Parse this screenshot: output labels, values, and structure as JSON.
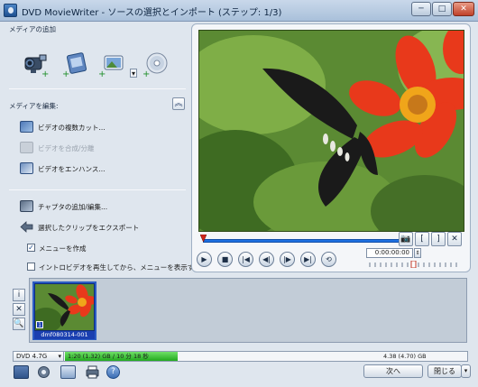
{
  "window": {
    "title": "DVD MovieWriter - ソースの選択とインポート (ステップ: 1/3)",
    "minimize": "─",
    "maximize": "□",
    "close": "✕"
  },
  "add_media": {
    "heading": "メディアの追加",
    "icons": [
      "camcorder-icon",
      "import-video-icon",
      "import-photo-icon",
      "disc-import-icon"
    ],
    "dropdown": "▾"
  },
  "edit_media": {
    "heading": "メディアを編集:",
    "collapse": "︽",
    "items": [
      {
        "label": "ビデオの複数カット...",
        "disabled": false
      },
      {
        "label": "ビデオを合成/分離",
        "disabled": true
      },
      {
        "label": "ビデオをエンハンス...",
        "disabled": false
      }
    ]
  },
  "chapter": {
    "add_chapters": "チャプタの追加/編集...",
    "export_clip": "選択したクリップをエクスポート",
    "create_menu": "メニューを作成",
    "create_menu_checked": true,
    "intro_option": "イントロビデオを再生してから、メニューを表示する",
    "intro_checked": false
  },
  "player": {
    "timecode": "0:00:00:00",
    "controls": [
      "▶",
      "■",
      "|◀",
      "◀|",
      "|▶",
      "▶|",
      "⟲"
    ],
    "camera": "📷",
    "mark_in": "[",
    "mark_out": "]",
    "delete": "✕"
  },
  "side_tools": [
    "i",
    "✕",
    "🔍"
  ],
  "clips": [
    {
      "label": "dmf080314-001",
      "index": "1"
    }
  ],
  "status": {
    "disc_type": "DVD 4.7G",
    "used": "1:20 (1.32) GB / 10 分 18 秒",
    "total": "4.38 (4.70) GB",
    "used_fraction": 0.28
  },
  "footer": {
    "next": "次へ",
    "close": "閉じる",
    "close_dropdown": "▾",
    "help": "?"
  },
  "colors": {
    "accent": "#2b5cc4",
    "progress_green": "#2fbf2a",
    "timeline_blue": "#1d6fe0"
  }
}
